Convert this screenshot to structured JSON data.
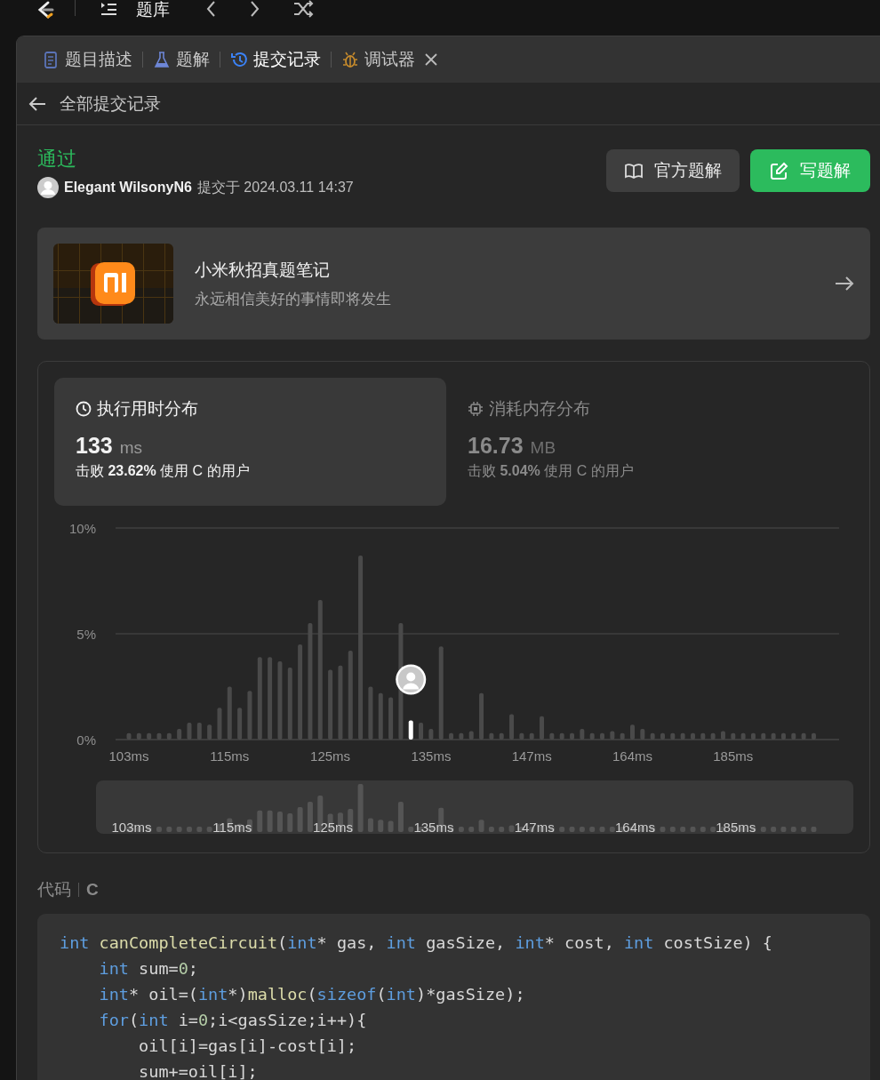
{
  "top_bar": {
    "title": "题库"
  },
  "tabs": [
    {
      "label": "题目描述",
      "kind": "description",
      "selected": false,
      "closable": false
    },
    {
      "label": "题解",
      "kind": "solutions",
      "selected": false,
      "closable": false
    },
    {
      "label": "提交记录",
      "kind": "submissions",
      "selected": true,
      "closable": false
    },
    {
      "label": "调试器",
      "kind": "debugger",
      "selected": false,
      "closable": true
    }
  ],
  "subheader": {
    "title": "全部提交记录"
  },
  "submission": {
    "status": "通过",
    "user": "Elegant WilsonyN6",
    "submitted_at": "提交于 2024.03.11 14:37"
  },
  "buttons": [
    {
      "label": "官方题解",
      "kind": "secondary"
    },
    {
      "label": "写题解",
      "kind": "primary"
    }
  ],
  "banner": {
    "title": "小米秋招真题笔记",
    "subtitle": "永远相信美好的事情即将发生"
  },
  "metrics": [
    {
      "title": "执行用时分布",
      "kind": "runtime",
      "value": "133",
      "unit": "ms",
      "beats": "击败 **23.62%** 使用 C 的用户",
      "selected": true
    },
    {
      "title": "消耗内存分布",
      "kind": "memory",
      "value": "16.73",
      "unit": "MB",
      "beats": "击败 **5.04%** 使用 C 的用户",
      "selected": false
    }
  ],
  "chart_data": {
    "type": "bar",
    "ylim": [
      0,
      10
    ],
    "yticks": [
      {
        "value": 0,
        "label": "0%"
      },
      {
        "value": 5,
        "label": "5%"
      },
      {
        "value": 10,
        "label": "10%"
      }
    ],
    "categories": [
      "103ms",
      null,
      null,
      null,
      null,
      null,
      null,
      null,
      null,
      null,
      "115ms",
      null,
      null,
      null,
      null,
      null,
      null,
      null,
      null,
      null,
      "125ms",
      null,
      null,
      null,
      null,
      null,
      null,
      null,
      null,
      null,
      "135ms",
      null,
      null,
      null,
      null,
      null,
      null,
      null,
      null,
      null,
      "147ms",
      null,
      null,
      null,
      null,
      null,
      null,
      null,
      null,
      null,
      "164ms",
      null,
      null,
      null,
      null,
      null,
      null,
      null,
      null,
      null,
      "185ms",
      null,
      null,
      null,
      null,
      null,
      null,
      null,
      null
    ],
    "values": [
      0.3,
      0.3,
      0.3,
      0.3,
      0.3,
      0.5,
      0.8,
      0.8,
      0.7,
      1.5,
      2.5,
      1.5,
      2.3,
      3.9,
      3.9,
      3.7,
      3.4,
      4.5,
      5.5,
      6.6,
      3.3,
      3.5,
      4.2,
      8.7,
      2.5,
      2.2,
      2.0,
      5.5,
      0.9,
      0.8,
      0.5,
      4.4,
      0.3,
      0.3,
      0.4,
      2.2,
      0.3,
      0.3,
      1.2,
      0.3,
      0.3,
      1.1,
      0.3,
      0.3,
      0.3,
      0.5,
      0.3,
      0.3,
      0.4,
      0.3,
      0.7,
      0.5,
      0.3,
      0.3,
      0.3,
      0.3,
      0.3,
      0.3,
      0.3,
      0.4,
      0.3,
      0.3,
      0.3,
      0.3,
      0.3,
      0.3,
      0.3,
      0.3,
      0.3
    ]
  },
  "bar_selected": [
    false,
    false,
    false,
    false,
    false,
    false,
    false,
    false,
    false,
    false,
    false,
    false,
    false,
    false,
    false,
    false,
    false,
    false,
    false,
    false,
    false,
    false,
    false,
    false,
    false,
    false,
    false,
    false,
    true,
    false,
    false,
    false,
    false,
    false,
    false,
    false,
    false,
    false,
    false,
    false,
    false,
    false,
    false,
    false,
    false,
    false,
    false,
    false,
    false,
    false,
    false,
    false,
    false,
    false,
    false,
    false,
    false,
    false,
    false,
    false,
    false,
    false,
    false,
    false,
    false,
    false,
    false,
    false,
    false
  ],
  "overview": {
    "tick_labels": [
      "103ms",
      "115ms",
      "125ms",
      "135ms",
      "147ms",
      "164ms",
      "185ms"
    ]
  },
  "code": {
    "label": "代码",
    "language": "C",
    "lines": [
      [
        {
          "text": "int",
          "kind": "keyword"
        },
        {
          "text": " canCompleteCircuit",
          "kind": "function"
        },
        {
          "text": "(",
          "kind": "plain"
        },
        {
          "text": "int",
          "kind": "keyword"
        },
        {
          "text": "* gas, ",
          "kind": "plain"
        },
        {
          "text": "int",
          "kind": "keyword"
        },
        {
          "text": " gasSize, ",
          "kind": "plain"
        },
        {
          "text": "int",
          "kind": "keyword"
        },
        {
          "text": "* cost, ",
          "kind": "plain"
        },
        {
          "text": "int",
          "kind": "keyword"
        },
        {
          "text": " costSize) {",
          "kind": "plain"
        }
      ],
      [
        {
          "text": "    int",
          "kind": "keyword"
        },
        {
          "text": " sum=",
          "kind": "plain"
        },
        {
          "text": "0",
          "kind": "number"
        },
        {
          "text": ";",
          "kind": "plain"
        }
      ],
      [
        {
          "text": "    int",
          "kind": "keyword"
        },
        {
          "text": "* oil=(",
          "kind": "plain"
        },
        {
          "text": "int",
          "kind": "keyword"
        },
        {
          "text": "*)",
          "kind": "plain"
        },
        {
          "text": "malloc",
          "kind": "function"
        },
        {
          "text": "(",
          "kind": "plain"
        },
        {
          "text": "sizeof",
          "kind": "keyword"
        },
        {
          "text": "(",
          "kind": "plain"
        },
        {
          "text": "int",
          "kind": "keyword"
        },
        {
          "text": ")*gasSize);",
          "kind": "plain"
        }
      ],
      [
        {
          "text": "    for",
          "kind": "keyword"
        },
        {
          "text": "(",
          "kind": "plain"
        },
        {
          "text": "int",
          "kind": "keyword"
        },
        {
          "text": " i=",
          "kind": "plain"
        },
        {
          "text": "0",
          "kind": "number"
        },
        {
          "text": ";i<gasSize;i++){",
          "kind": "plain"
        }
      ],
      [
        {
          "text": "        oil[i]=gas[i]-cost[i];",
          "kind": "plain"
        }
      ],
      [
        {
          "text": "        sum+=oil[i];",
          "kind": "plain"
        }
      ]
    ]
  }
}
